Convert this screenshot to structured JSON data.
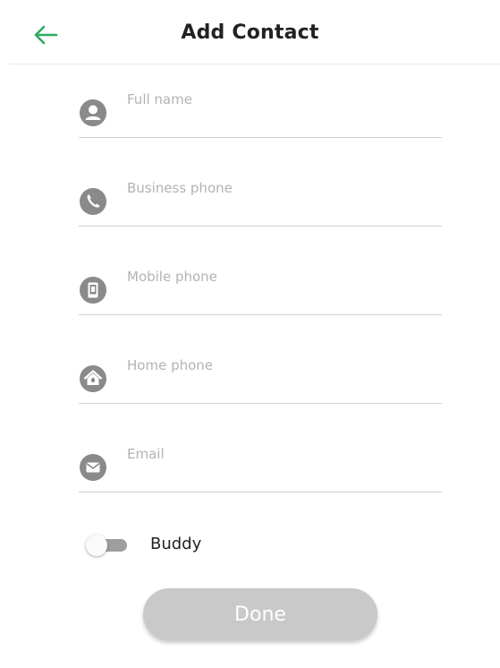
{
  "header": {
    "title": "Add Contact",
    "back_icon": "arrow-left-icon",
    "accent_color": "#2eaa5e"
  },
  "form": {
    "fields": [
      {
        "icon": "person-icon",
        "placeholder": "Full name",
        "value": ""
      },
      {
        "icon": "phone-icon",
        "placeholder": "Business phone",
        "value": ""
      },
      {
        "icon": "mobile-icon",
        "placeholder": "Mobile phone",
        "value": ""
      },
      {
        "icon": "home-icon",
        "placeholder": "Home phone",
        "value": ""
      },
      {
        "icon": "email-icon",
        "placeholder": "Email",
        "value": ""
      }
    ],
    "icon_color": "#8a8a8a"
  },
  "buddy": {
    "label": "Buddy",
    "enabled": false
  },
  "done_button": {
    "label": "Done",
    "disabled": true,
    "color": "#c9c9c9"
  }
}
